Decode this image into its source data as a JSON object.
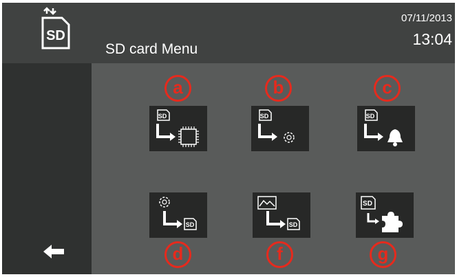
{
  "header": {
    "title": "SD card Menu",
    "date": "07/11/2013",
    "time": "13:04",
    "logo_text": "SD"
  },
  "menu": [
    {
      "id": "a",
      "badge": "a",
      "icon_text": "SD",
      "icon": "sd-to-device-icon"
    },
    {
      "id": "b",
      "badge": "b",
      "icon_text": "SD",
      "icon": "sd-to-settings-icon"
    },
    {
      "id": "c",
      "badge": "c",
      "icon_text": "SD",
      "icon": "sd-to-alarm-icon"
    },
    {
      "id": "d",
      "badge": "d",
      "icon_text": "SD",
      "icon": "settings-to-sd-icon"
    },
    {
      "id": "f",
      "badge": "f",
      "icon_text": "SD",
      "icon": "graph-to-sd-icon"
    },
    {
      "id": "g",
      "badge": "g",
      "icon_text": "SD",
      "icon": "sd-to-plugin-icon"
    }
  ],
  "navigation": {
    "back_icon": "back-arrow-icon"
  },
  "colors": {
    "header": "#404241",
    "background": "#595b5a",
    "sidebar": "#2f3130",
    "tile": "#272827",
    "badge": "#e62a1d"
  }
}
